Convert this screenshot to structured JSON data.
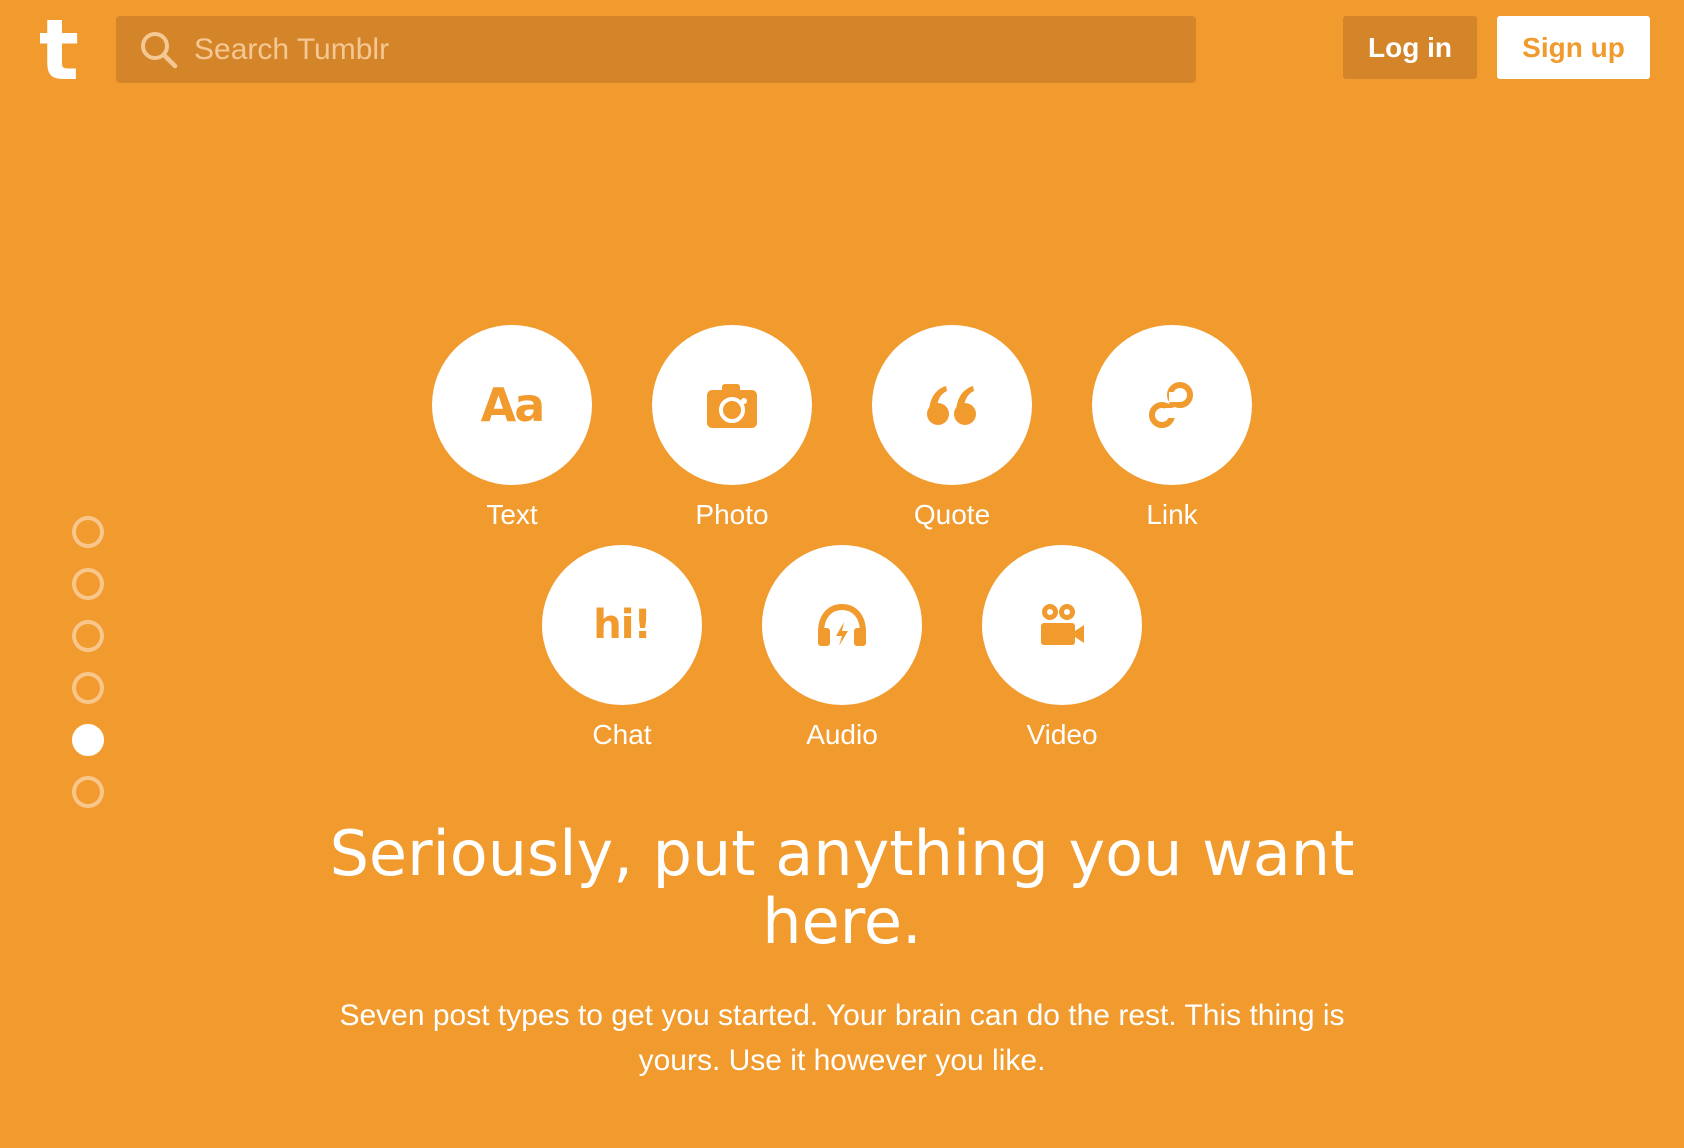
{
  "brand": {
    "logo_text": "t",
    "background_color": "#F19A2E",
    "search_bg_color": "#D4852A",
    "accent_white": "#FFFFFF"
  },
  "header": {
    "search_placeholder": "Search Tumblr",
    "login_label": "Log in",
    "signup_label": "Sign up"
  },
  "pager": {
    "total_dots": 6,
    "active_index": 4
  },
  "post_types": [
    {
      "label": "Text",
      "icon": "text-aa-icon",
      "glyph": "Aa"
    },
    {
      "label": "Photo",
      "icon": "camera-icon"
    },
    {
      "label": "Quote",
      "icon": "quote-icon",
      "glyph": "“"
    },
    {
      "label": "Link",
      "icon": "link-icon"
    },
    {
      "label": "Chat",
      "icon": "chat-hi-icon",
      "glyph": "hi!"
    },
    {
      "label": "Audio",
      "icon": "headphones-icon"
    },
    {
      "label": "Video",
      "icon": "video-camera-icon"
    }
  ],
  "headline": "Seriously, put anything you want here.",
  "subhead": "Seven post types to get you started. Your brain can do the rest. This thing is yours. Use it however you like."
}
